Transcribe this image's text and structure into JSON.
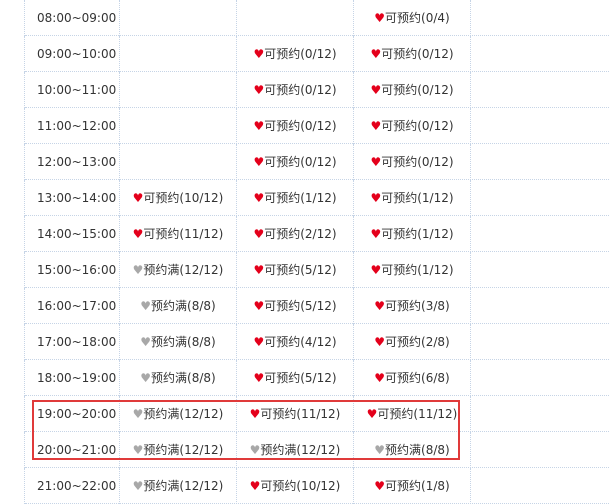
{
  "schedule": {
    "rows": [
      {
        "time": "08:00~09:00",
        "slots": [
          null,
          null,
          {
            "state": "available",
            "text": "可预约(0/4)"
          }
        ]
      },
      {
        "time": "09:00~10:00",
        "slots": [
          null,
          {
            "state": "available",
            "text": "可预约(0/12)"
          },
          {
            "state": "available",
            "text": "可预约(0/12)"
          }
        ]
      },
      {
        "time": "10:00~11:00",
        "slots": [
          null,
          {
            "state": "available",
            "text": "可预约(0/12)"
          },
          {
            "state": "available",
            "text": "可预约(0/12)"
          }
        ]
      },
      {
        "time": "11:00~12:00",
        "slots": [
          null,
          {
            "state": "available",
            "text": "可预约(0/12)"
          },
          {
            "state": "available",
            "text": "可预约(0/12)"
          }
        ]
      },
      {
        "time": "12:00~13:00",
        "slots": [
          null,
          {
            "state": "available",
            "text": "可预约(0/12)"
          },
          {
            "state": "available",
            "text": "可预约(0/12)"
          }
        ]
      },
      {
        "time": "13:00~14:00",
        "slots": [
          {
            "state": "available",
            "text": "可预约(10/12)"
          },
          {
            "state": "available",
            "text": "可预约(1/12)"
          },
          {
            "state": "available",
            "text": "可预约(1/12)"
          }
        ]
      },
      {
        "time": "14:00~15:00",
        "slots": [
          {
            "state": "available",
            "text": "可预约(11/12)"
          },
          {
            "state": "available",
            "text": "可预约(2/12)"
          },
          {
            "state": "available",
            "text": "可预约(1/12)"
          }
        ]
      },
      {
        "time": "15:00~16:00",
        "slots": [
          {
            "state": "full",
            "text": "预约满(12/12)"
          },
          {
            "state": "available",
            "text": "可预约(5/12)"
          },
          {
            "state": "available",
            "text": "可预约(1/12)"
          }
        ]
      },
      {
        "time": "16:00~17:00",
        "slots": [
          {
            "state": "full",
            "text": "预约满(8/8)"
          },
          {
            "state": "available",
            "text": "可预约(5/12)"
          },
          {
            "state": "available",
            "text": "可预约(3/8)"
          }
        ]
      },
      {
        "time": "17:00~18:00",
        "slots": [
          {
            "state": "full",
            "text": "预约满(8/8)"
          },
          {
            "state": "available",
            "text": "可预约(4/12)"
          },
          {
            "state": "available",
            "text": "可预约(2/8)"
          }
        ]
      },
      {
        "time": "18:00~19:00",
        "slots": [
          {
            "state": "full",
            "text": "预约满(8/8)"
          },
          {
            "state": "available",
            "text": "可预约(5/12)"
          },
          {
            "state": "available",
            "text": "可预约(6/8)"
          }
        ]
      },
      {
        "time": "19:00~20:00",
        "slots": [
          {
            "state": "full",
            "text": "预约满(12/12)"
          },
          {
            "state": "available",
            "text": "可预约(11/12)"
          },
          {
            "state": "available",
            "text": "可预约(11/12)"
          }
        ]
      },
      {
        "time": "20:00~21:00",
        "slots": [
          {
            "state": "full",
            "text": "预约满(12/12)"
          },
          {
            "state": "full",
            "text": "预约满(12/12)"
          },
          {
            "state": "full",
            "text": "预约满(8/8)"
          }
        ]
      },
      {
        "time": "21:00~22:00",
        "slots": [
          {
            "state": "full",
            "text": "预约满(12/12)"
          },
          {
            "state": "available",
            "text": "可预约(10/12)"
          },
          {
            "state": "available",
            "text": "可预约(1/8)"
          }
        ]
      }
    ]
  },
  "icons": {
    "available": "heart-icon-red",
    "full": "heart-icon-gray"
  },
  "colors": {
    "available_heart": "#e4001b",
    "full_heart": "#a8a8a8",
    "highlight_border": "#e03a3a",
    "grid_line": "#c6d4e6"
  }
}
